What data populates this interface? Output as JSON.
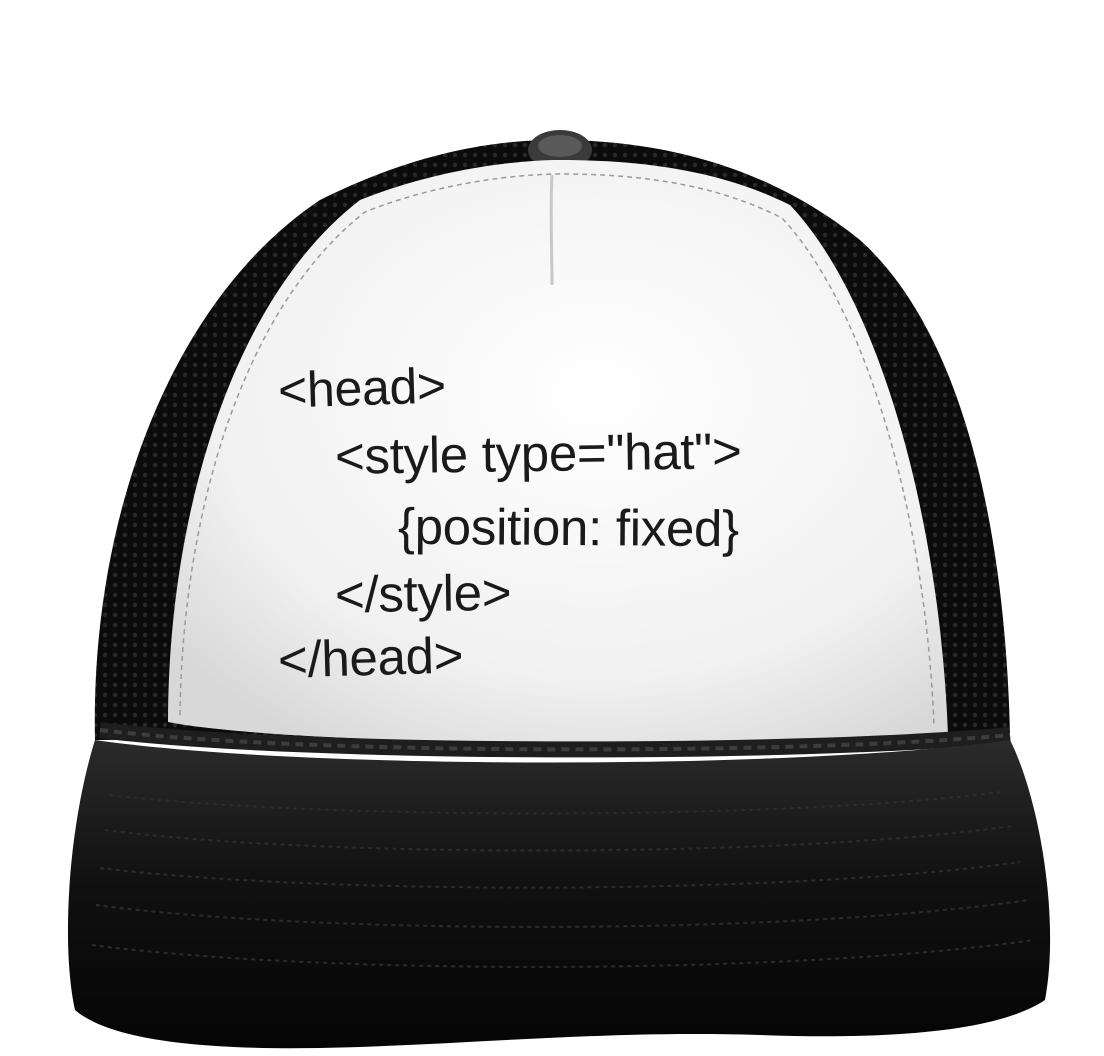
{
  "hat": {
    "code_lines": [
      "<head>",
      "<style type=\"hat\">",
      "{position: fixed}",
      "</style>",
      "</head>"
    ]
  },
  "colors": {
    "mesh": "#0d0d0d",
    "front_panel": "#f4f4f4",
    "brim": "#141414",
    "text": "#1a1a1a"
  }
}
